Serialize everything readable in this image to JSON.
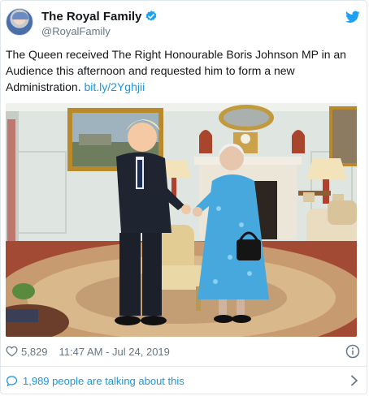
{
  "account": {
    "display_name": "The Royal Family",
    "handle": "@RoyalFamily"
  },
  "tweet": {
    "text": "The Queen received The Right Honourable Boris Johnson MP in an Audience this afternoon and requested him to form a new Administration.",
    "link_text": "bit.ly/2Yghjii"
  },
  "stats": {
    "likes": "5,829",
    "timestamp": "11:47 AM - Jul 24, 2019"
  },
  "conversation": {
    "label": "1,989 people are talking about this"
  },
  "icons": {
    "verified": "verified-badge-icon",
    "bird": "twitter-bird-icon",
    "like": "heart-icon",
    "info": "info-icon",
    "talk": "speech-bubble-icon",
    "chevron": "chevron-right-icon"
  },
  "colors": {
    "accent": "#1da1f2",
    "link": "#1b95e0",
    "muted": "#657786",
    "border": "#e1e8ed"
  }
}
